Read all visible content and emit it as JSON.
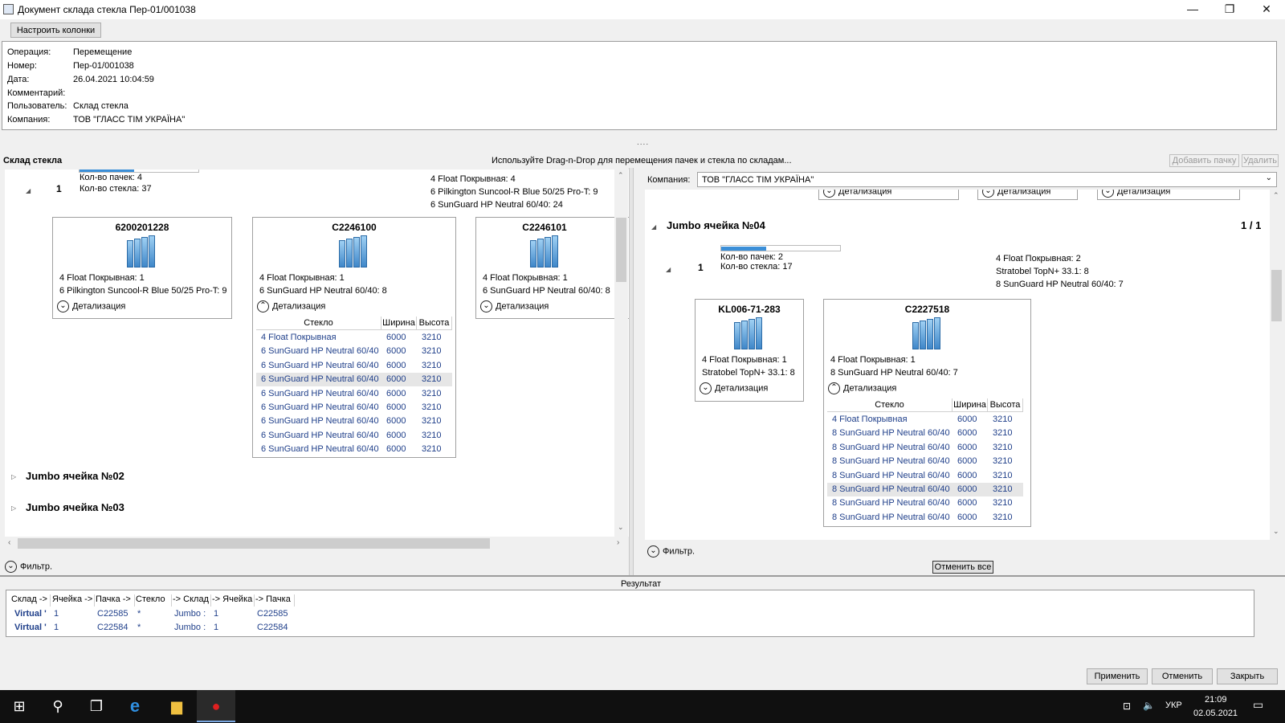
{
  "window": {
    "title": "Документ склада стекла Пер-01/001038",
    "btn_minimize": "—",
    "btn_restore": "❐",
    "btn_close": "✕"
  },
  "toolbar": {
    "config_columns": "Настроить колонки"
  },
  "info": [
    {
      "label": "Операция:",
      "value": "Перемещение"
    },
    {
      "label": "Номер:",
      "value": "Пер-01/001038"
    },
    {
      "label": "Дата:",
      "value": "26.04.2021 10:04:59"
    },
    {
      "label": "Комментарий:",
      "value": ""
    },
    {
      "label": "Пользователь:",
      "value": "Склад стекла"
    },
    {
      "label": "Компания:",
      "value": "ТОВ \"ГЛАСС ТІМ УКРАЇНА\""
    }
  ],
  "splitter_grip": "....",
  "left": {
    "title": "Склад стекла",
    "hint": "Используйте Drag-n-Drop для перемещения пачек и стекла по складам...",
    "group": {
      "num": "1",
      "packs": "Кол-во пачек: 4",
      "glass": "Кол-во стекла: 37",
      "progress": 0.46,
      "summary": [
        "4 Float Покрывная: 4",
        "6 Pilkington Suncool-R Blue 50/25 Pro-T: 9",
        "6 SunGuard HP Neutral 60/40: 24"
      ]
    },
    "cards": [
      {
        "id": "6200201228",
        "lines": [
          "4 Float Покрывная: 1",
          "6 Pilkington Suncool-R Blue 50/25 Pro-T: 9"
        ],
        "detail": "Детализация",
        "expanded": false
      },
      {
        "id": "C2246100",
        "lines": [
          "4 Float Покрывная: 1",
          "6 SunGuard HP Neutral 60/40: 8"
        ],
        "detail": "Детализация",
        "expanded": true
      },
      {
        "id": "C2246101",
        "lines": [
          "4 Float Покрывная: 1",
          "6 SunGuard HP Neutral 60/40: 8"
        ],
        "detail": "Детализация",
        "expanded": false
      }
    ],
    "grid": {
      "headers": [
        "Стекло",
        "Ширина",
        "Высота"
      ],
      "rows": [
        [
          "4 Float Покрывная",
          "6000",
          "3210"
        ],
        [
          "6 SunGuard HP Neutral 60/40",
          "6000",
          "3210"
        ],
        [
          "6 SunGuard HP Neutral 60/40",
          "6000",
          "3210"
        ],
        [
          "6 SunGuard HP Neutral 60/40",
          "6000",
          "3210"
        ],
        [
          "6 SunGuard HP Neutral 60/40",
          "6000",
          "3210"
        ],
        [
          "6 SunGuard HP Neutral 60/40",
          "6000",
          "3210"
        ],
        [
          "6 SunGuard HP Neutral 60/40",
          "6000",
          "3210"
        ],
        [
          "6 SunGuard HP Neutral 60/40",
          "6000",
          "3210"
        ],
        [
          "6 SunGuard HP Neutral 60/40",
          "6000",
          "3210"
        ]
      ],
      "selected_row": 3
    },
    "cells": [
      "Jumbo ячейка №02",
      "Jumbo ячейка №03"
    ],
    "filter": "Фильтр."
  },
  "right": {
    "add_pack": "Добавить пачку",
    "delete": "Удалить",
    "company_label": "Компания:",
    "company_value": "ТОВ \"ГЛАСС ТІМ УКРАЇНА\"",
    "top_details": [
      "Детализация",
      "Детализация",
      "Детализация"
    ],
    "cell_title": "Jumbo ячейка №04",
    "cell_count": "1 / 1",
    "group": {
      "num": "1",
      "packs": "Кол-во пачек: 2",
      "glass": "Кол-во стекла: 17",
      "progress": 0.38,
      "summary": [
        "4 Float Покрывная: 2",
        "Stratobel TopN+ 33.1: 8",
        "8 SunGuard HP Neutral 60/40: 7"
      ]
    },
    "cards": [
      {
        "id": "KL006-71-283",
        "lines": [
          "4 Float Покрывная: 1",
          "Stratobel TopN+ 33.1: 8"
        ],
        "detail": "Детализация",
        "expanded": false
      },
      {
        "id": "C2227518",
        "lines": [
          "4 Float Покрывная: 1",
          "8 SunGuard HP Neutral 60/40: 7"
        ],
        "detail": "Детализация",
        "expanded": true
      }
    ],
    "grid": {
      "headers": [
        "Стекло",
        "Ширина",
        "Высота"
      ],
      "rows": [
        [
          "4 Float Покрывная",
          "6000",
          "3210"
        ],
        [
          "8 SunGuard HP Neutral 60/40",
          "6000",
          "3210"
        ],
        [
          "8 SunGuard HP Neutral 60/40",
          "6000",
          "3210"
        ],
        [
          "8 SunGuard HP Neutral 60/40",
          "6000",
          "3210"
        ],
        [
          "8 SunGuard HP Neutral 60/40",
          "6000",
          "3210"
        ],
        [
          "8 SunGuard HP Neutral 60/40",
          "6000",
          "3210"
        ],
        [
          "8 SunGuard HP Neutral 60/40",
          "6000",
          "3210"
        ],
        [
          "8 SunGuard HP Neutral 60/40",
          "6000",
          "3210"
        ]
      ],
      "selected_row": 5
    },
    "filter": "Фильтр.",
    "cancel_all": "Отменить все"
  },
  "result": {
    "title": "Результат",
    "headers": [
      "Склад ->",
      "Ячейка ->",
      "Пачка ->",
      "Стекло",
      "-> Склад",
      "-> Ячейка",
      "-> Пачка"
    ],
    "rows": [
      [
        "Virtual '",
        "1",
        "C22585",
        "*",
        "Jumbo :",
        "1",
        "C22585"
      ],
      [
        "Virtual '",
        "1",
        "C22584",
        "*",
        "Jumbo :",
        "1",
        "C22584"
      ]
    ]
  },
  "footer": {
    "apply": "Применить",
    "cancel": "Отменить",
    "close": "Закрыть"
  },
  "taskbar": {
    "lang": "УКР",
    "time": "21:09",
    "date": "02.05.2021"
  }
}
